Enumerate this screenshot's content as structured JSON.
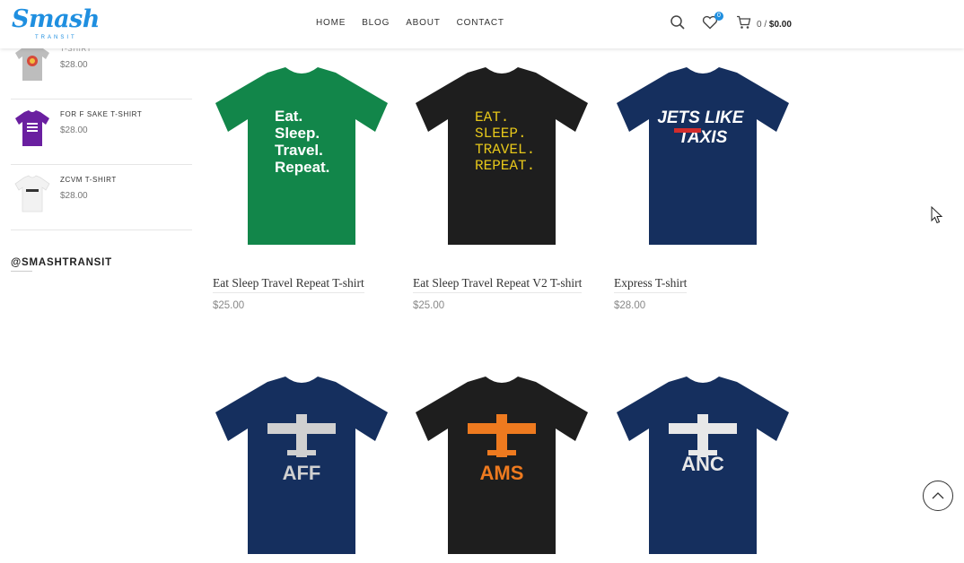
{
  "header": {
    "logo_text": "Smash",
    "logo_sub": "TRANSIT",
    "nav": [
      "HOME",
      "BLOG",
      "ABOUT",
      "CONTACT"
    ],
    "wishlist_count": "0",
    "cart_count": "0 /",
    "cart_total": "$0.00"
  },
  "sidebar": {
    "items": [
      {
        "name": "T-SHIRT",
        "price": "$28.00",
        "color": "#bdbdbd"
      },
      {
        "name": "FOR F SAKE T-SHIRT",
        "price": "$28.00",
        "color": "#6a1fa0"
      },
      {
        "name": "ZCVM T-SHIRT",
        "price": "$28.00",
        "color": "#f2f2f2"
      }
    ],
    "handle": "@SMASHTRANSIT"
  },
  "products": [
    {
      "name": "Eat Sleep Travel Repeat T-shirt",
      "price": "$25.00",
      "shirt_color": "#12864a",
      "print": [
        "Eat.",
        "Sleep.",
        "Travel.",
        "Repeat."
      ],
      "print_color": "#ffffff"
    },
    {
      "name": "Eat Sleep Travel Repeat V2 T-shirt",
      "price": "$25.00",
      "shirt_color": "#1e1e1e",
      "print": [
        "EAT.",
        "SLEEP.",
        "TRAVEL.",
        "REPEAT."
      ],
      "print_color": "#e5c61a"
    },
    {
      "name": "Express T-shirt",
      "price": "$28.00",
      "shirt_color": "#152f5e",
      "print": [
        "JETS LIKE",
        "TAXIS"
      ],
      "print_color": "#ffffff"
    },
    {
      "name": "",
      "price": "",
      "shirt_color": "#152f5e",
      "print": [
        "AFF"
      ],
      "print_color": "#d0d0d0"
    },
    {
      "name": "",
      "price": "",
      "shirt_color": "#1e1e1e",
      "print": [
        "AMS"
      ],
      "print_color": "#ee7a1f"
    },
    {
      "name": "",
      "price": "",
      "shirt_color": "#152f5e",
      "print": [
        "ANC"
      ],
      "print_color": "#e8e8e8"
    }
  ]
}
